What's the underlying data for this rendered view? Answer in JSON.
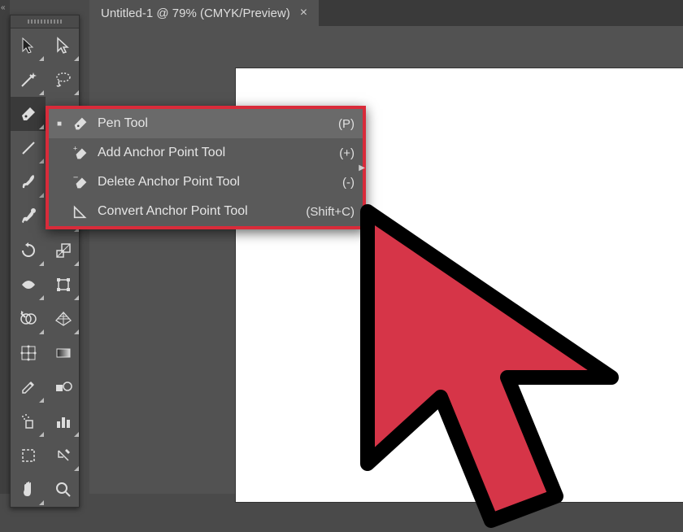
{
  "tab": {
    "title": "Untitled-1 @ 79% (CMYK/Preview)"
  },
  "flyout": {
    "items": [
      {
        "name": "pen",
        "label": "Pen Tool",
        "shortcut": "(P)",
        "selected": true
      },
      {
        "name": "add-anchor",
        "label": "Add Anchor Point Tool",
        "shortcut": "(+)",
        "selected": false
      },
      {
        "name": "delete-anchor",
        "label": "Delete Anchor Point Tool",
        "shortcut": "(-)",
        "selected": false
      },
      {
        "name": "convert-anchor",
        "label": "Convert Anchor Point Tool",
        "shortcut": "(Shift+C)",
        "selected": false
      }
    ]
  },
  "tools": [
    [
      "selection",
      "direct-selection"
    ],
    [
      "magic-wand",
      "lasso"
    ],
    [
      "pen",
      "type"
    ],
    [
      "line",
      "shape"
    ],
    [
      "paintbrush",
      "pencil"
    ],
    [
      "blob-brush",
      "eraser"
    ],
    [
      "rotate",
      "scale"
    ],
    [
      "width",
      "free-transform"
    ],
    [
      "shape-builder",
      "perspective"
    ],
    [
      "mesh",
      "gradient"
    ],
    [
      "eyedropper",
      "blend"
    ],
    [
      "symbol-sprayer",
      "graph"
    ],
    [
      "artboard",
      "slice"
    ],
    [
      "hand",
      "zoom"
    ]
  ]
}
